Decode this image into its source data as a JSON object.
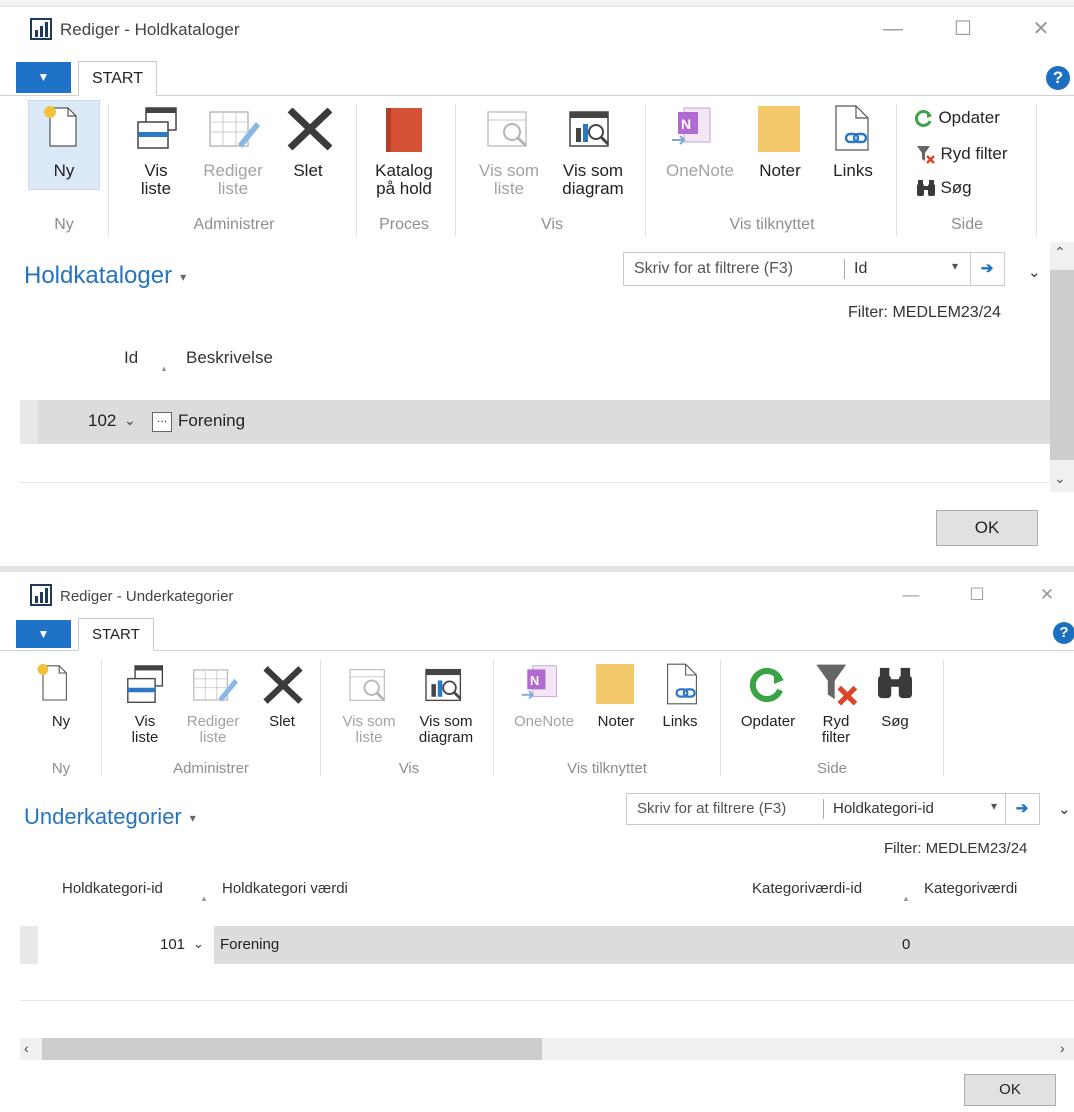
{
  "window1": {
    "title": "Rediger - Holdkataloger",
    "tab": "START",
    "help": "?",
    "ribbon": {
      "new_label": "Ny",
      "view_list_label": "Vis liste",
      "edit_list_label": "Rediger liste",
      "delete_label": "Slet",
      "catalog_label": "Katalog på hold",
      "view_as_list_label": "Vis som liste",
      "view_as_chart_label": "Vis som diagram",
      "onenote_label": "OneNote",
      "notes_label": "Noter",
      "links_label": "Links",
      "refresh_label": "Opdater",
      "clear_filter_label": "Ryd filter",
      "search_label": "Søg",
      "groups": [
        "Ny",
        "Administrer",
        "Proces",
        "Vis",
        "Vis tilknyttet",
        "Side"
      ]
    },
    "page_title": "Holdkataloger",
    "filter_placeholder": "Skriv for at filtrere (F3)",
    "filter_field": "Id",
    "filter_text": "Filter: MEDLEM23/24",
    "columns": [
      "Id",
      "Beskrivelse"
    ],
    "rows": [
      {
        "id": "102",
        "description": "Forening"
      }
    ],
    "ok_label": "OK"
  },
  "window2": {
    "title": "Rediger - Underkategorier",
    "tab": "START",
    "help": "?",
    "ribbon": {
      "new_label": "Ny",
      "view_list_label": "Vis liste",
      "edit_list_label": "Rediger liste",
      "delete_label": "Slet",
      "view_as_list_label": "Vis som liste",
      "view_as_chart_label": "Vis som diagram",
      "onenote_label": "OneNote",
      "notes_label": "Noter",
      "links_label": "Links",
      "refresh_label": "Opdater",
      "clear_filter_label": "Ryd filter",
      "search_label": "Søg",
      "groups": [
        "Ny",
        "Administrer",
        "Vis",
        "Vis tilknyttet",
        "Side"
      ]
    },
    "page_title": "Underkategorier",
    "filter_placeholder": "Skriv for at filtrere (F3)",
    "filter_field": "Holdkategori-id",
    "filter_text": "Filter: MEDLEM23/24",
    "columns": [
      "Holdkategori-id",
      "Holdkategori værdi",
      "Kategoriværdi-id",
      "Kategoriværdi"
    ],
    "rows": [
      {
        "category_id": "101",
        "category_value": "Forening",
        "value_id": "0",
        "value": ""
      }
    ],
    "ok_label": "OK"
  },
  "colors": {
    "accent": "#1e73c8",
    "title_blue": "#2574c0",
    "row_selected": "#dcdcdc"
  }
}
